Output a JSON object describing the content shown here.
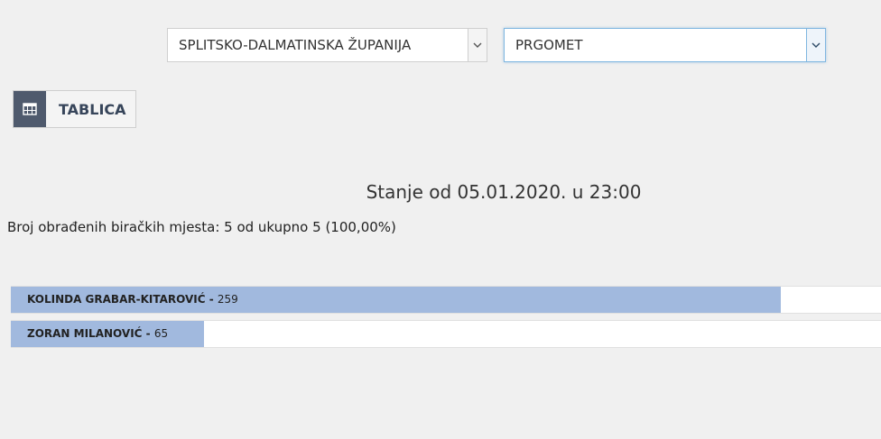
{
  "filters": {
    "county": {
      "selected": "SPLITSKO-DALMATINSKA ŽUPANIJA",
      "icon": "chevron-down-icon"
    },
    "town": {
      "selected": "PRGOMET",
      "icon": "chevron-down-icon"
    }
  },
  "view_toggle": {
    "label": "TABLICA",
    "icon": "table-icon",
    "icon_bg": "#4f5a6d"
  },
  "status": {
    "title": "Stanje od 05.01.2020. u 23:00",
    "processed": "Broj obrađenih biračkih mjesta: 5 od ukupno 5 (100,00%)"
  },
  "results": {
    "bar_color": "#a1b9de",
    "candidates": [
      {
        "name": "KOLINDA GRABAR-KITAROVIĆ",
        "sep": " - ",
        "votes": "259",
        "share": 0.885
      },
      {
        "name": "ZORAN MILANOVIĆ",
        "sep": " - ",
        "votes": "65",
        "share": 0.222
      }
    ]
  }
}
